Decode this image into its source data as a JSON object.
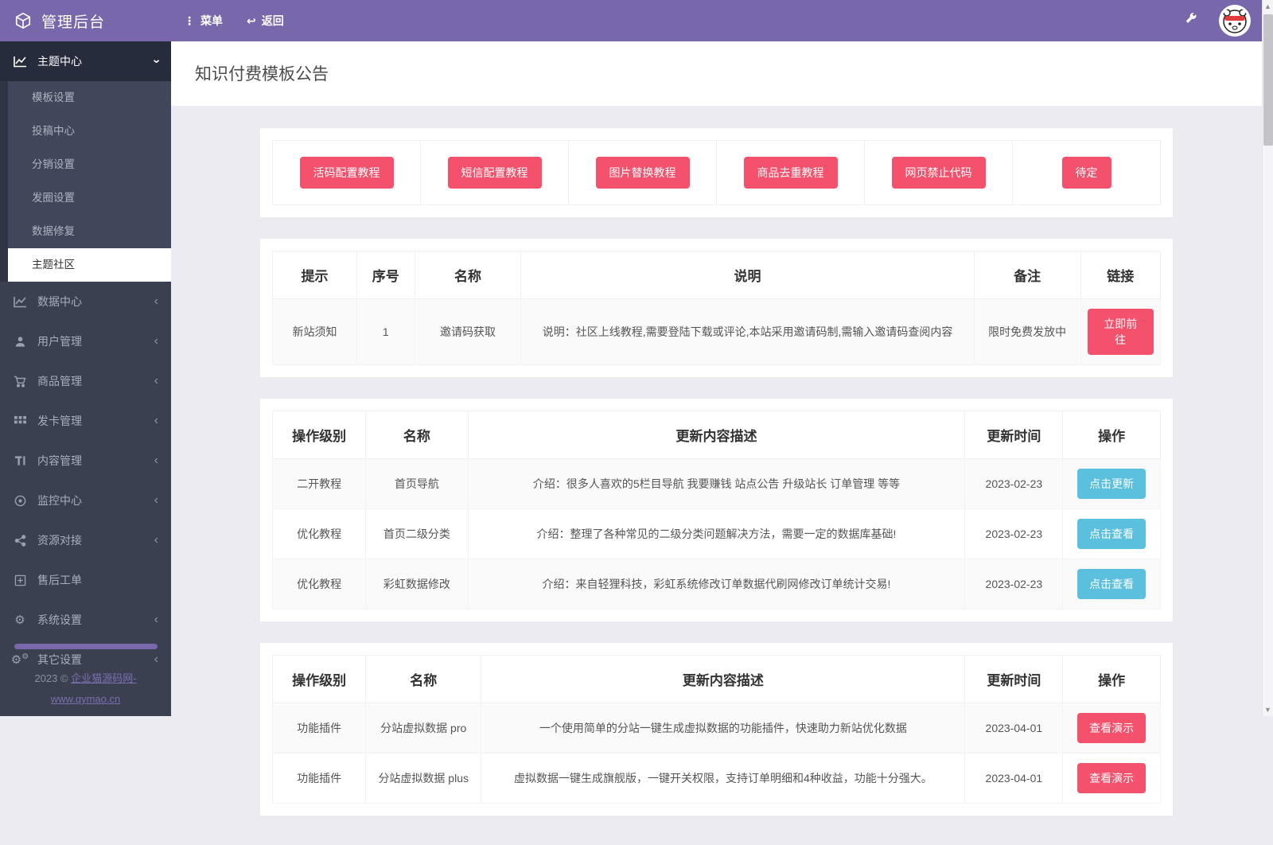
{
  "header": {
    "brand": "管理后台",
    "menu": "菜单",
    "back": "返回"
  },
  "sidebar": {
    "theme_center": {
      "label": "主题中心"
    },
    "submenu": [
      {
        "label": "模板设置"
      },
      {
        "label": "投稿中心"
      },
      {
        "label": "分销设置"
      },
      {
        "label": "发圈设置"
      },
      {
        "label": "数据修复"
      },
      {
        "label": "主题社区"
      }
    ],
    "items": [
      {
        "label": "数据中心"
      },
      {
        "label": "用户管理"
      },
      {
        "label": "商品管理"
      },
      {
        "label": "发卡管理"
      },
      {
        "label": "内容管理"
      },
      {
        "label": "监控中心"
      },
      {
        "label": "资源对接"
      },
      {
        "label": "售后工单"
      },
      {
        "label": "系统设置"
      },
      {
        "label": "其它设置"
      }
    ],
    "footer": {
      "copyright": "2023 © ",
      "site_name": "企业猫源码网-",
      "site_url": "www.qymao.cn"
    }
  },
  "page": {
    "title": "知识付费模板公告"
  },
  "quick_links": {
    "buttons": [
      "活码配置教程",
      "短信配置教程",
      "图片替换教程",
      "商品去重教程",
      "网页禁止代码",
      "待定"
    ]
  },
  "notice_table": {
    "headers": [
      "提示",
      "序号",
      "名称",
      "说明",
      "备注",
      "链接"
    ],
    "rows": [
      {
        "tip": "新站须知",
        "no": "1",
        "name": "邀请码获取",
        "desc": "说明：社区上线教程,需要登陆下载或评论,本站采用邀请码制,需输入邀请码查阅内容",
        "note": "限时免费发放中",
        "action": "立即前往"
      }
    ]
  },
  "tutorial_table": {
    "headers": [
      "操作级别",
      "名称",
      "更新内容描述",
      "更新时间",
      "操作"
    ],
    "rows": [
      {
        "level": "二开教程",
        "name": "首页导航",
        "desc": "介绍：很多人喜欢的5栏目导航 我要赚钱 站点公告 升级站长 订单管理 等等",
        "date": "2023-02-23",
        "action": "点击更新"
      },
      {
        "level": "优化教程",
        "name": "首页二级分类",
        "desc": "介绍：整理了各种常见的二级分类问题解决方法，需要一定的数据库基础!",
        "date": "2023-02-23",
        "action": "点击查看"
      },
      {
        "level": "优化教程",
        "name": "彩虹数据修改",
        "desc": "介绍：来自轻狸科技，彩虹系统修改订单数据代刷网修改订单统计交易!",
        "date": "2023-02-23",
        "action": "点击查看"
      }
    ]
  },
  "plugin_table": {
    "headers": [
      "操作级别",
      "名称",
      "更新内容描述",
      "更新时间",
      "操作"
    ],
    "rows": [
      {
        "level": "功能插件",
        "name": "分站虚拟数据 pro",
        "desc": "一个使用简单的分站一键生成虚拟数据的功能插件，快速助力新站优化数据",
        "date": "2023-04-01",
        "action": "查看演示"
      },
      {
        "level": "功能插件",
        "name": "分站虚拟数据 plus",
        "desc": "虚拟数据一键生成旗舰版，一键开关权限，支持订单明细和4种收益，功能十分强大。",
        "date": "2023-04-01",
        "action": "查看演示"
      }
    ]
  },
  "colors": {
    "accent_purple": "#7867aa",
    "danger_red": "#f4516c",
    "info_blue": "#5bc0de",
    "sidebar_bg": "#3a4050",
    "sidebar_active_bg": "#272c3d",
    "content_bg": "#edebf2"
  }
}
